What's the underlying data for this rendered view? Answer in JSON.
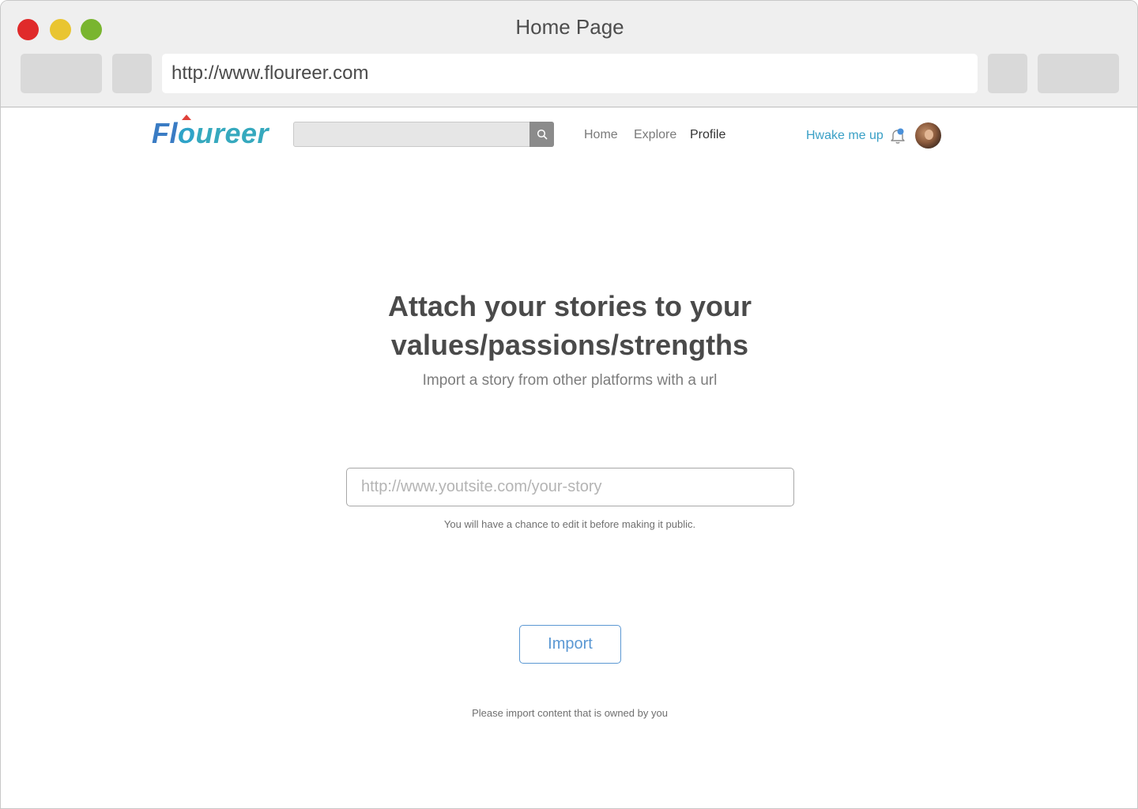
{
  "window": {
    "title": "Home Page",
    "address_url": "http://www.floureer.com"
  },
  "header": {
    "logo_text_left": "Fl",
    "logo_text_o": "o",
    "logo_text_right": "ureer",
    "search_placeholder": "",
    "nav": {
      "home": "Home",
      "explore": "Explore",
      "profile": "Profile"
    },
    "active_nav": "Profile",
    "hwake_label": "Hwake me up"
  },
  "main": {
    "headline_line1": "Attach your stories to your",
    "headline_line2": "values/passions/strengths",
    "subheadline": "Import a story from other platforms with a url",
    "url_placeholder": "http://www.youtsite.com/your-story",
    "helper_text": "You will have a chance to edit it before making it public.",
    "import_label": "Import",
    "ownership_note": "Please import content that is owned by you"
  },
  "colors": {
    "accent_blue": "#5b98d3",
    "link_teal": "#3aa0c6",
    "logo_blue": "#3a7cc4",
    "logo_hat_red": "#e0413a",
    "close_red": "#e02a2a",
    "minimize_yellow": "#e9c531",
    "maximize_green": "#79b52f"
  },
  "icons": {
    "search": "search-icon",
    "bell": "bell-icon",
    "avatar": "avatar"
  }
}
